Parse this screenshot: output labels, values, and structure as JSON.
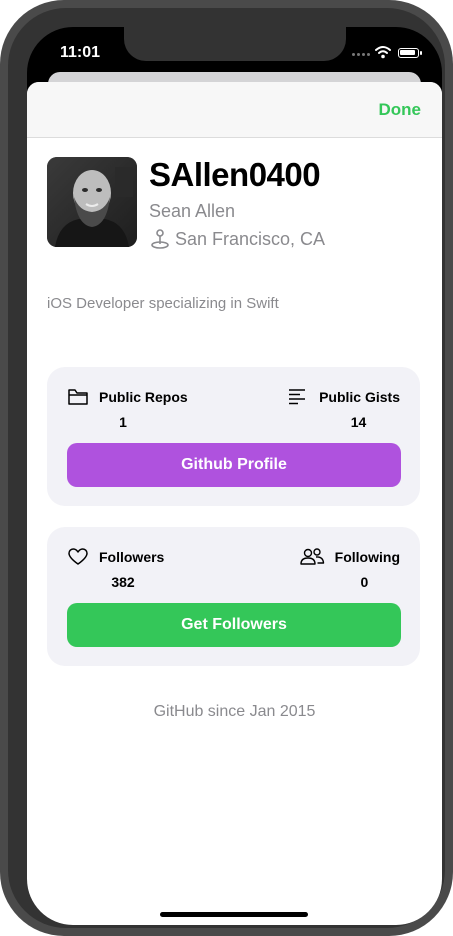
{
  "status_bar": {
    "time": "11:01"
  },
  "navbar": {
    "done_label": "Done"
  },
  "profile": {
    "username": "SAllen0400",
    "name": "Sean Allen",
    "location": "San Francisco, CA",
    "bio": "iOS Developer specializing in Swift"
  },
  "repo_card": {
    "left": {
      "icon": "folder-icon",
      "label": "Public Repos",
      "count": "1"
    },
    "right": {
      "icon": "text-align-left-icon",
      "label": "Public Gists",
      "count": "14"
    },
    "button_label": "Github Profile"
  },
  "follower_card": {
    "left": {
      "icon": "heart-icon",
      "label": "Followers",
      "count": "382"
    },
    "right": {
      "icon": "person-2-icon",
      "label": "Following",
      "count": "0"
    },
    "button_label": "Get Followers"
  },
  "footer": {
    "since": "GitHub since Jan 2015"
  },
  "colors": {
    "accent_green": "#34c759",
    "purple": "#af52de",
    "card_bg": "#f2f2f7",
    "secondary_text": "#8a8a8e"
  }
}
